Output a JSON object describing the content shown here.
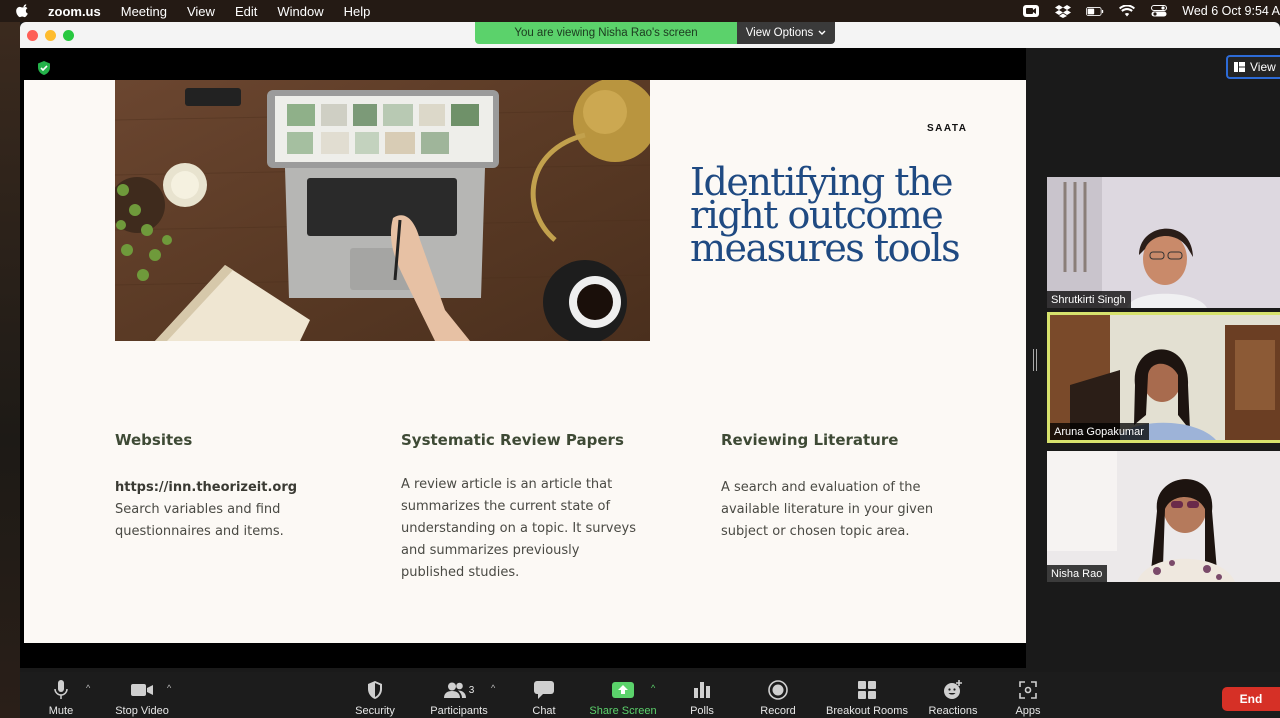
{
  "menubar": {
    "app": "zoom.us",
    "items": [
      "Meeting",
      "View",
      "Edit",
      "Window",
      "Help"
    ],
    "clock": "Wed 6 Oct  9:54 A"
  },
  "banner": {
    "message": "You are viewing Nisha Rao's screen",
    "options_label": "View Options"
  },
  "slide": {
    "brand": "SAATA",
    "title": "Identifying the right outcome measures tools",
    "columns": [
      {
        "heading": "Websites",
        "link": "https://inn.theorizeit.org",
        "body": "Search variables and find questionnaires and items."
      },
      {
        "heading": "Systematic Review Papers",
        "body": "A review article is an article that summarizes the current state of understanding on a topic. It surveys and summarizes previously published studies."
      },
      {
        "heading": "Reviewing Literature",
        "body": "A search and evaluation of the available literature in your given subject or chosen topic area."
      }
    ]
  },
  "gallery": {
    "view_label": "View",
    "participants": [
      {
        "name": "Shrutkirti Singh"
      },
      {
        "name": "Aruna Gopakumar"
      },
      {
        "name": "Nisha Rao"
      }
    ]
  },
  "toolbar": {
    "mute": "Mute",
    "stop_video": "Stop Video",
    "security": "Security",
    "participants": "Participants",
    "participants_count": "3",
    "chat": "Chat",
    "share_screen": "Share Screen",
    "polls": "Polls",
    "record": "Record",
    "breakout_rooms": "Breakout Rooms",
    "reactions": "Reactions",
    "apps": "Apps",
    "end": "End"
  },
  "colors": {
    "accent_green": "#5bd26b",
    "end_red": "#d63026",
    "title_blue": "#1f4a82",
    "active_speaker": "#d7e26d"
  }
}
